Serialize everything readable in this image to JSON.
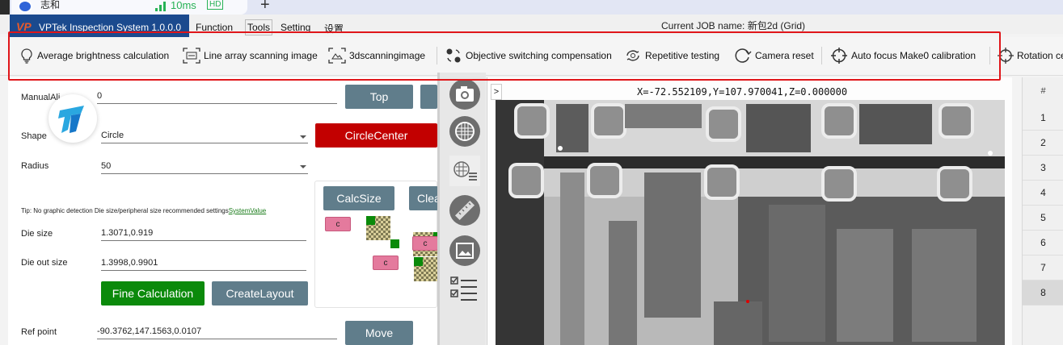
{
  "overlay": {
    "user_name": "志和",
    "latency": "10ms",
    "quality_badge": "HD",
    "new_tab_symbol": "+"
  },
  "app": {
    "logo_text": "VP",
    "title": "VPTek Inspection System 1.0.0.0",
    "job_label": "Current JOB name: 新包2d (Grid)"
  },
  "menu": [
    "Function",
    "Tools",
    "Setting",
    "设置"
  ],
  "toolbar": {
    "items": [
      {
        "label": "Average brightness calculation",
        "icon": "lightbulb-icon"
      },
      {
        "label": "Line array scanning image",
        "icon": "line-scan-icon"
      },
      {
        "label": "3dscanningimage",
        "icon": "3d-scan-icon"
      },
      {
        "label": "Objective switching compensation",
        "icon": "objective-icon"
      },
      {
        "label": "Repetitive testing",
        "icon": "repeat-icon"
      },
      {
        "label": "Camera reset",
        "icon": "reset-icon"
      },
      {
        "label": "Auto focus Make0 calibration",
        "icon": "crosshair-icon"
      },
      {
        "label": "Rotation ce",
        "icon": "rotation-icon"
      }
    ]
  },
  "form": {
    "manual_label": "ManualAli",
    "manual_value": "0",
    "top_button": "Top",
    "shape_label": "Shape",
    "shape_value": "Circle",
    "circle_center_button": "CircleCenter",
    "radius_label": "Radius",
    "radius_value": "50",
    "calc_size_button": "CalcSize",
    "clear_button": "Clea",
    "tip_text": "Tip: No graphic detection Die size/peripheral size recommended settings",
    "tip_link": "SystemValue",
    "die_size_label": "Die size",
    "die_size_value": "1.3071,0.919",
    "die_out_size_label": "Die out size",
    "die_out_size_value": "1.3998,0.9901",
    "fine_calc_button": "Fine Calculation",
    "create_layout_button": "CreateLayout",
    "ref_point_label": "Ref point",
    "ref_point_value": "-90.3762,147.1563,0.0107",
    "move_button": "Move",
    "diagram_box_label": "c"
  },
  "viewer": {
    "expand_symbol": ">",
    "coords": "X=-72.552109,Y=107.970041,Z=0.000000"
  },
  "vbar_icons": [
    "camera-icon",
    "grid-globe-icon",
    "grid-list-icon",
    "ruler-icon",
    "image-frame-icon",
    "checklist-icon"
  ],
  "right_list": {
    "header": "#",
    "rows": [
      "1",
      "2",
      "3",
      "4",
      "5",
      "6",
      "7",
      "8"
    ],
    "selected": "8"
  },
  "colors": {
    "brand_bg": "#1b4a8e",
    "highlight_red": "#e0161a",
    "button_gray": "#607d8b",
    "button_red": "#c20000",
    "button_green": "#0b8a0b",
    "link_green": "#1a7c1a"
  }
}
